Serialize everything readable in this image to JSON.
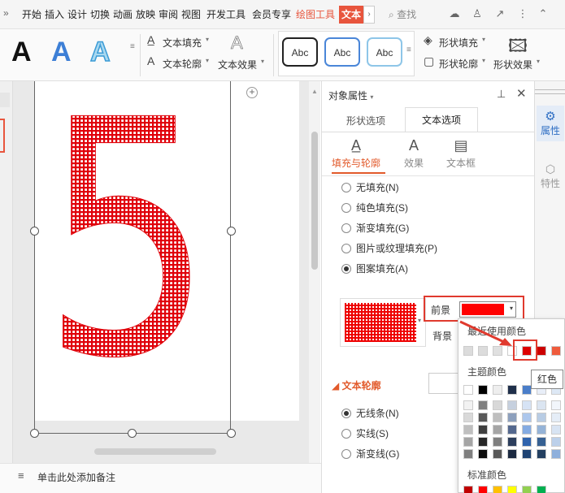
{
  "menubar": {
    "items": [
      "开始",
      "插入",
      "设计",
      "切换",
      "动画",
      "放映",
      "审阅",
      "视图",
      "开发工具",
      "会员专享"
    ],
    "active_item": "绘图工具",
    "current_tab": "文本",
    "search_label": "查找"
  },
  "ribbon": {
    "text_fill": "文本填充",
    "text_outline": "文本轮廓",
    "text_effects": "文本效果",
    "shape_fill": "形状填充",
    "shape_outline": "形状轮廓",
    "shape_effects": "形状效果",
    "style_glyph": "A",
    "shape_style_label": "Abc"
  },
  "canvas": {
    "big_glyph": "5",
    "note_placeholder": "单击此处添加备注"
  },
  "panel": {
    "title": "对象属性",
    "tabs": [
      "形状选项",
      "文本选项"
    ],
    "active_tab": "文本选项",
    "subtabs": [
      "填充与轮廓",
      "效果",
      "文本框"
    ],
    "fill_options": [
      {
        "label": "无填充(N)",
        "checked": false
      },
      {
        "label": "纯色填充(S)",
        "checked": false
      },
      {
        "label": "渐变填充(G)",
        "checked": false
      },
      {
        "label": "图片或纹理填充(P)",
        "checked": false
      },
      {
        "label": "图案填充(A)",
        "checked": true
      }
    ],
    "foreground_label": "前景",
    "background_label": "背景",
    "foreground_color": "#ff0000",
    "outline_section": "文本轮廓",
    "outline_options": [
      {
        "label": "无线条(N)",
        "checked": true
      },
      {
        "label": "实线(S)",
        "checked": false
      },
      {
        "label": "渐变线(G)",
        "checked": false
      }
    ]
  },
  "sidebar": {
    "properties": "属性",
    "features": "特性"
  },
  "color_popup": {
    "recent_header": "最近使用颜色",
    "theme_header": "主题颜色",
    "standard_header": "标准颜色",
    "tooltip": "红色",
    "recent_colors": [
      "#dcdcdc",
      "#dcdcdc",
      "#e0e0e0",
      "#ffffff",
      "#dd0000",
      "#cc0000",
      "#ef5b3c"
    ],
    "theme_top_row": [
      "#ffffff",
      "#000000",
      "#eeeeee",
      "#1f2f4a",
      "#4a7ec9",
      "#e8eef8",
      "#dde8f5"
    ],
    "standard_colors": [
      "#c00000",
      "#ff0000",
      "#ffc000",
      "#ffff00",
      "#92d050",
      "#00b050"
    ]
  }
}
